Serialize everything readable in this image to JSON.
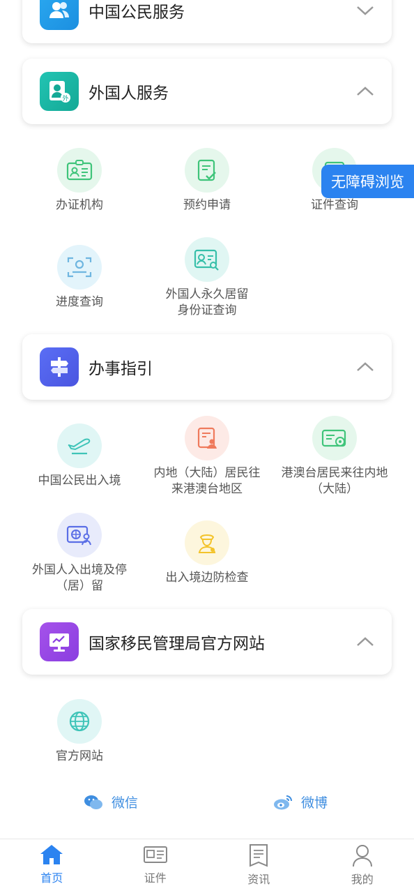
{
  "sections": [
    {
      "title": "中国公民服务",
      "expanded": false,
      "color": "#1e9be6"
    },
    {
      "title": "外国人服务",
      "expanded": true,
      "color": "#19b8a5"
    },
    {
      "title": "办事指引",
      "expanded": true,
      "color": "#5064ee"
    },
    {
      "title": "国家移民管理局官方网站",
      "expanded": true,
      "color": "#9b4ce6"
    }
  ],
  "foreigner_items": [
    {
      "label": "办证机构",
      "icon": "id-card-icon"
    },
    {
      "label": "预约申请",
      "icon": "form-check-icon"
    },
    {
      "label": "证件查询",
      "icon": "document-search-icon"
    },
    {
      "label": "进度查询",
      "icon": "scan-person-icon"
    },
    {
      "label": "外国人永久居留\n身份证查询",
      "icon": "card-search-icon"
    }
  ],
  "guide_items": [
    {
      "label": "中国公民出入境",
      "icon": "plane-icon"
    },
    {
      "label": "内地（大陆）居民往\n来港澳台地区",
      "icon": "permit-person-icon"
    },
    {
      "label": "港澳台居民来往内地\n（大陆）",
      "icon": "card-stamp-icon"
    },
    {
      "label": "外国人入出境及停\n（居）留",
      "icon": "passport-person-icon"
    },
    {
      "label": "出入境边防检查",
      "icon": "officer-icon"
    }
  ],
  "website_items": [
    {
      "label": "官方网站",
      "icon": "globe-icon"
    }
  ],
  "accessibility_button": "无障碍浏览",
  "social": {
    "wechat": "微信",
    "weibo": "微博"
  },
  "tabs": [
    {
      "label": "首页",
      "icon": "home-icon",
      "active": true
    },
    {
      "label": "证件",
      "icon": "id-card-icon",
      "active": false
    },
    {
      "label": "资讯",
      "icon": "news-icon",
      "active": false
    },
    {
      "label": "我的",
      "icon": "user-icon",
      "active": false
    }
  ],
  "colors": {
    "accent": "#2b83f0",
    "link": "#3f8ee0"
  }
}
